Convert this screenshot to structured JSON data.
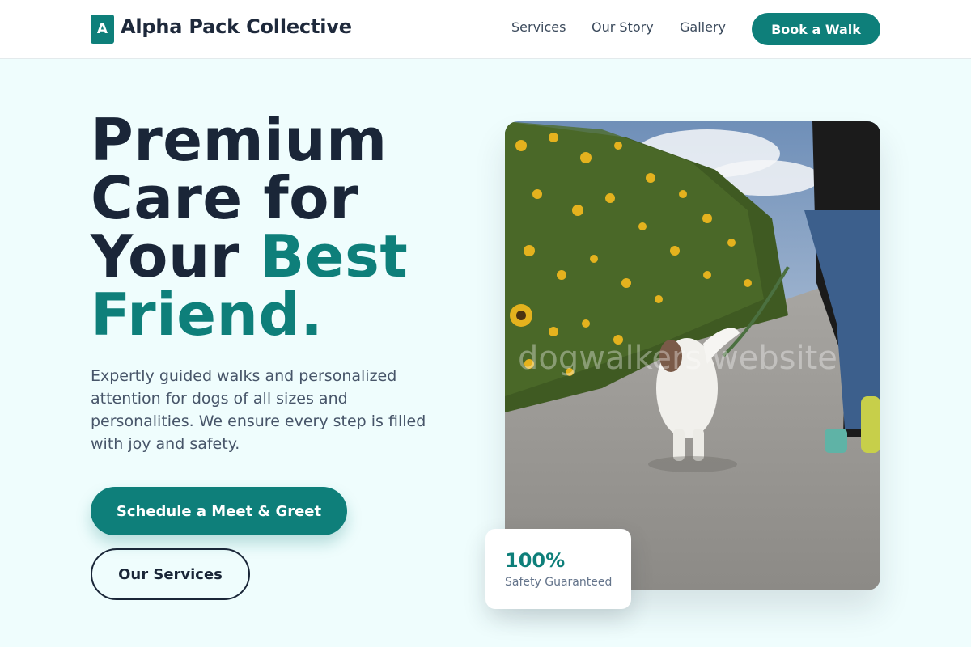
{
  "header": {
    "logo_letter": "A",
    "brand": "Alpha Pack Collective",
    "nav": [
      "Services",
      "Our Story",
      "Gallery"
    ],
    "cta": "Book a Walk"
  },
  "hero": {
    "headline_line1": "Premium",
    "headline_line2": "Care for",
    "headline_line3a": "Your ",
    "headline_line3b": "Best",
    "headline_line4": "Friend.",
    "subtext": "Expertly guided walks and personalized attention for dogs of all sizes and personalities. We ensure every step is filled with joy and safety.",
    "primary_button": "Schedule a Meet & Greet",
    "secondary_button": "Our Services"
  },
  "photo": {
    "watermark": "dogwalkers website"
  },
  "stat": {
    "value": "100%",
    "label": "Safety Guaranteed"
  },
  "colors": {
    "accent": "#0e7f7a",
    "heading": "#1a2638",
    "background": "#effdfd"
  }
}
